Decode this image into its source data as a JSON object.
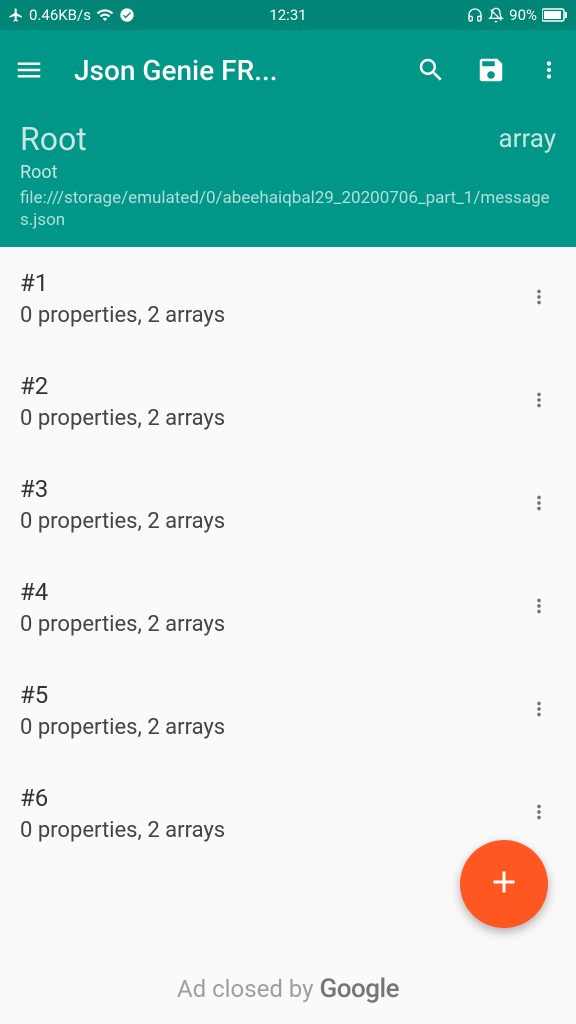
{
  "status_bar": {
    "speed": "0.46KB/s",
    "time": "12:31",
    "battery_percent": "90%"
  },
  "app_bar": {
    "title": "Json Genie FR..."
  },
  "breadcrumb": {
    "title": "Root",
    "type": "array",
    "sub": "Root",
    "path": "file:///storage/emulated/0/abeehaiqbal29_20200706_part_1/messages.json"
  },
  "items": [
    {
      "title": "#1",
      "sub": "0 properties, 2 arrays"
    },
    {
      "title": "#2",
      "sub": "0 properties, 2 arrays"
    },
    {
      "title": "#3",
      "sub": "0 properties, 2 arrays"
    },
    {
      "title": "#4",
      "sub": "0 properties, 2 arrays"
    },
    {
      "title": "#5",
      "sub": "0 properties, 2 arrays"
    },
    {
      "title": "#6",
      "sub": "0 properties, 2 arrays"
    }
  ],
  "ad": {
    "text": "Ad closed by",
    "brand": "Google"
  }
}
